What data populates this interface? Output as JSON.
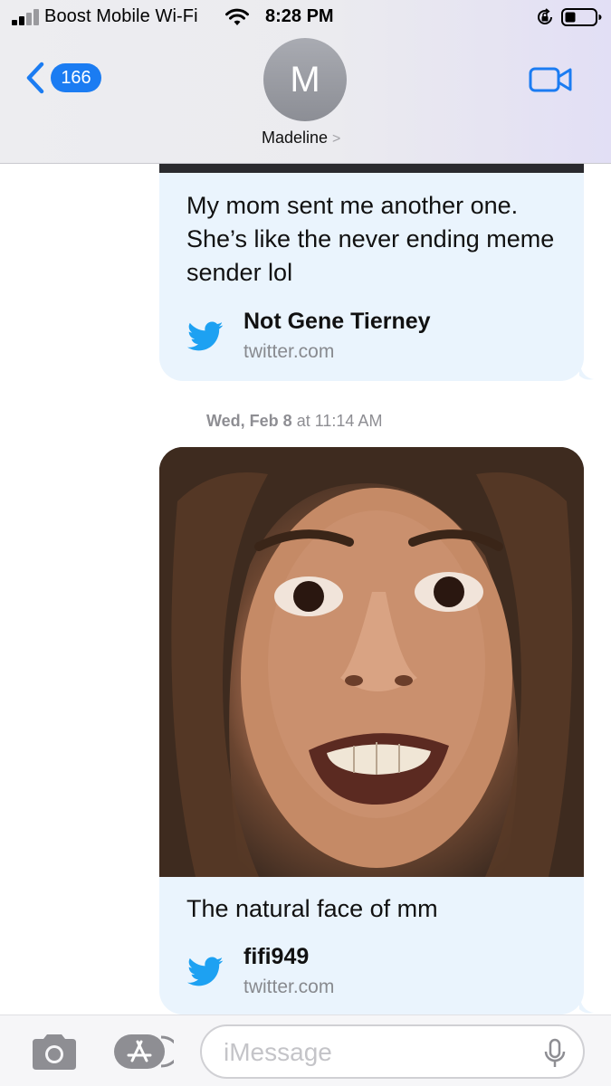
{
  "status_bar": {
    "carrier": "Boost Mobile Wi-Fi",
    "time": "8:28 PM"
  },
  "nav": {
    "back_count": "166",
    "avatar_initial": "M",
    "contact_name": "Madeline",
    "name_chevron": ">"
  },
  "messages": [
    {
      "text": "My mom sent me another one. She’s like the never ending meme sender lol",
      "link_title": "Not Gene Tierney",
      "link_domain": "twitter.com"
    },
    {
      "text": "The natural face of mm",
      "link_title": "fifi949",
      "link_domain": "twitter.com"
    }
  ],
  "timestamp": {
    "day": "Wed, Feb 8",
    "time": "at 11:14 AM"
  },
  "input": {
    "placeholder": "iMessage"
  },
  "colors": {
    "accent": "#1b7cf2",
    "bubble": "#eaf4fd",
    "twitter": "#1da1f2"
  },
  "icons": [
    "cellular-signal-icon",
    "wifi-icon",
    "rotation-lock-icon",
    "battery-icon",
    "back-chevron-icon",
    "video-camera-icon",
    "twitter-icon",
    "camera-icon",
    "app-store-icon",
    "microphone-icon"
  ]
}
